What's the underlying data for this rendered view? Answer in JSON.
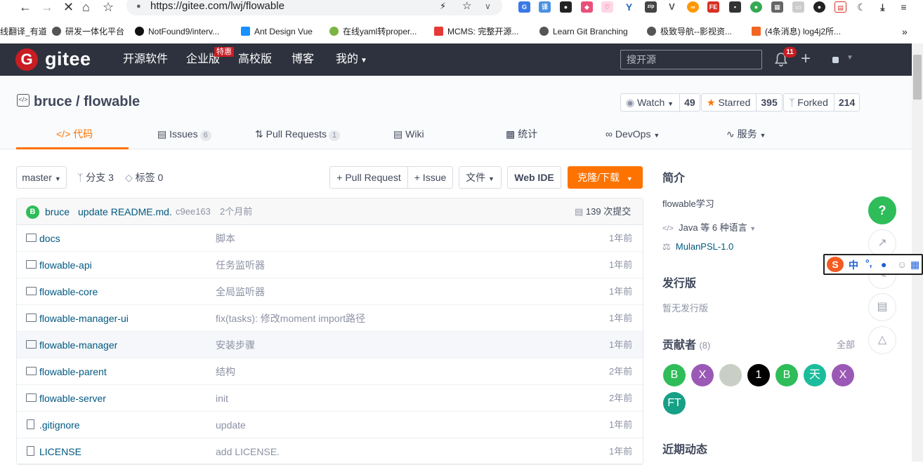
{
  "browser": {
    "url": "https://gitee.com/lwj/flowable",
    "bookmarks": [
      "线翻译_有道",
      "研发一体化平台",
      "NotFound9/interv...",
      "Ant Design Vue",
      "在线yaml转proper...",
      "MCMS: 完整开源...",
      "Learn Git Branching",
      "极致导航--影视资...",
      "(4条消息) log4j2所..."
    ],
    "bookmark_more": "»"
  },
  "header": {
    "logo_text": "gitee",
    "logo_mark": "G",
    "nav": [
      "开源软件",
      "企业版",
      "高校版",
      "博客",
      "我的"
    ],
    "hot_badge": "特惠",
    "search_placeholder": "搜开源",
    "notif_count": "11"
  },
  "repo": {
    "name": "bruce / flowable",
    "watch_label": "Watch",
    "watch_count": "49",
    "star_label": "Starred",
    "star_count": "395",
    "fork_label": "Forked",
    "fork_count": "214",
    "tabs": [
      {
        "label": "代码"
      },
      {
        "label": "Issues",
        "count": "6"
      },
      {
        "label": "Pull Requests",
        "count": "1"
      },
      {
        "label": "Wiki"
      },
      {
        "label": "统计"
      },
      {
        "label": "DevOps"
      },
      {
        "label": "服务"
      }
    ]
  },
  "toolbar": {
    "branch": "master",
    "branches": "分支 3",
    "tags": "标签 0",
    "pull_request": "+ Pull Request",
    "issue": "+ Issue",
    "file": "文件",
    "webide": "Web IDE",
    "clone": "克隆/下载"
  },
  "commit": {
    "avatar": "B",
    "author": "bruce",
    "message": "update README.md.",
    "hash": "c9ee163",
    "time": "2个月前",
    "count": "139 次提交"
  },
  "files": [
    {
      "name": "docs",
      "desc": "脚本",
      "time": "1年前",
      "type": "folder"
    },
    {
      "name": "flowable-api",
      "desc": "任务监听器",
      "time": "1年前",
      "type": "folder"
    },
    {
      "name": "flowable-core",
      "desc": "全局监听器",
      "time": "1年前",
      "type": "folder"
    },
    {
      "name": "flowable-manager-ui",
      "desc": "fix(tasks): 修改moment import路径",
      "time": "1年前",
      "type": "folder"
    },
    {
      "name": "flowable-manager",
      "desc": "安装步骤",
      "time": "1年前",
      "type": "folder"
    },
    {
      "name": "flowable-parent",
      "desc": "结构",
      "time": "2年前",
      "type": "folder"
    },
    {
      "name": "flowable-server",
      "desc": "init",
      "time": "2年前",
      "type": "folder"
    },
    {
      "name": ".gitignore",
      "desc": "update",
      "time": "1年前",
      "type": "file"
    },
    {
      "name": "LICENSE",
      "desc": "add LICENSE.",
      "time": "1年前",
      "type": "file"
    }
  ],
  "sidebar": {
    "intro_title": "简介",
    "intro": "flowable学习",
    "language": "Java 等 6 种语言",
    "license": "MulanPSL-1.0",
    "release_title": "发行版",
    "release_none": "暂无发行版",
    "contrib_title": "贡献者",
    "contrib_count": "(8)",
    "contrib_all": "全部",
    "contributors": [
      {
        "label": "B",
        "color": "#2ebd59"
      },
      {
        "label": "X",
        "color": "#9b59b6"
      },
      {
        "label": "",
        "color": "#c9cfc4"
      },
      {
        "label": "1",
        "color": "#000000"
      },
      {
        "label": "B",
        "color": "#2ebd59"
      },
      {
        "label": "天",
        "color": "#1bbc9b"
      },
      {
        "label": "X",
        "color": "#9b59b6"
      },
      {
        "label": "FT",
        "color": "#16a085"
      }
    ],
    "activity_title": "近期动态"
  },
  "ime": {
    "text": "中"
  },
  "float": {
    "help": "?"
  }
}
